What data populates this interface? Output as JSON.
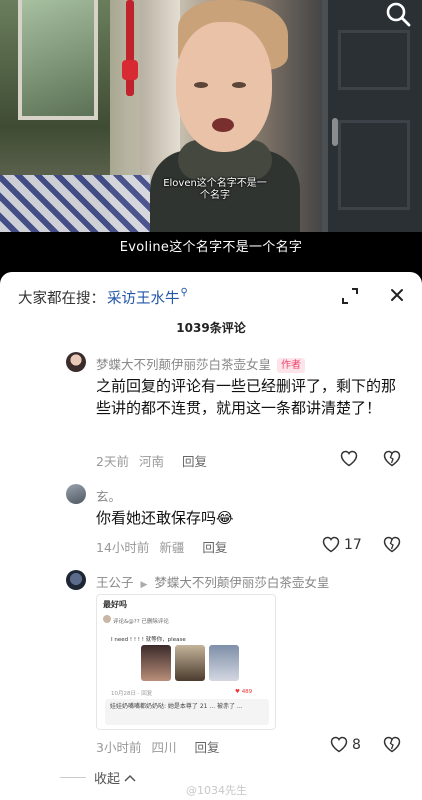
{
  "video": {
    "caption": "Eloven这个名字不是一个名字",
    "subtitle": "Evoline这个名字不是一个名字",
    "search_icon": "search-icon"
  },
  "sheet": {
    "search_prefix": "大家都在搜：",
    "search_term": "采访王水牛",
    "search_term_icon": "search-icon",
    "comment_count": "1039条评论",
    "expand_icon": "expand-icon",
    "close_icon": "close-icon"
  },
  "comments": [
    {
      "username": "梦蝶大不列颠伊丽莎白茶壶女皇",
      "badge": "作者",
      "text": "之前回复的评论有一些已经删评了，剩下的那些讲的都不连贯，就用这一条都讲清楚了！",
      "time": "2天前",
      "location": "河南",
      "reply": "回复",
      "likes": ""
    },
    {
      "username": "玄。",
      "text": "你看她还敢保存吗😂",
      "time": "14小时前",
      "location": "新疆",
      "reply": "回复",
      "likes": "17"
    },
    {
      "username": "王公子",
      "reply_to": "梦蝶大不列颠伊丽莎白茶壶女皇",
      "time": "3小时前",
      "location": "四川",
      "reply": "回复",
      "likes": "8"
    }
  ],
  "card": {
    "title": "最好吗",
    "sub": "评论&@??  已删除评论",
    "line": "I need ! ! ! ! 就等你，please",
    "meta": "10月28日 ·  回复",
    "likes": "489",
    "quote": "娃娃奶嘴嘴都奶奶哒: 她是本尊了 21 ... 被赤了 ..."
  },
  "footer": {
    "collapse": "收起",
    "watermark": "@1034先生"
  }
}
